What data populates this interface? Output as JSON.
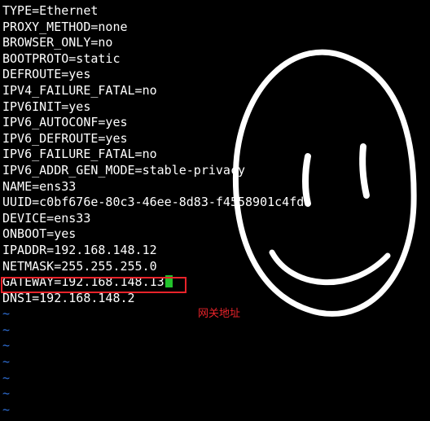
{
  "terminal": {
    "lines": [
      "TYPE=Ethernet",
      "PROXY_METHOD=none",
      "BROWSER_ONLY=no",
      "BOOTPROTO=static",
      "DEFROUTE=yes",
      "IPV4_FAILURE_FATAL=no",
      "IPV6INIT=yes",
      "IPV6_AUTOCONF=yes",
      "IPV6_DEFROUTE=yes",
      "IPV6_FAILURE_FATAL=no",
      "IPV6_ADDR_GEN_MODE=stable-privacy",
      "NAME=ens33",
      "UUID=c0bf676e-80c3-46ee-8d83-f4558901c4fd",
      "DEVICE=ens33",
      "ONBOOT=yes",
      "IPADDR=192.168.148.12",
      "NETMASK=255.255.255.0",
      "GATEWAY=192.168.148.13",
      "DNS1=192.168.148.2"
    ],
    "empty_line_marker": "~",
    "cursor_color": "#22c22c",
    "tilde_color": "#2f6fd6"
  },
  "annotation": {
    "text": "网关地址",
    "color": "#e8232a"
  },
  "overlay": {
    "icon": "smiley-face-icon",
    "color": "#ffffff"
  }
}
